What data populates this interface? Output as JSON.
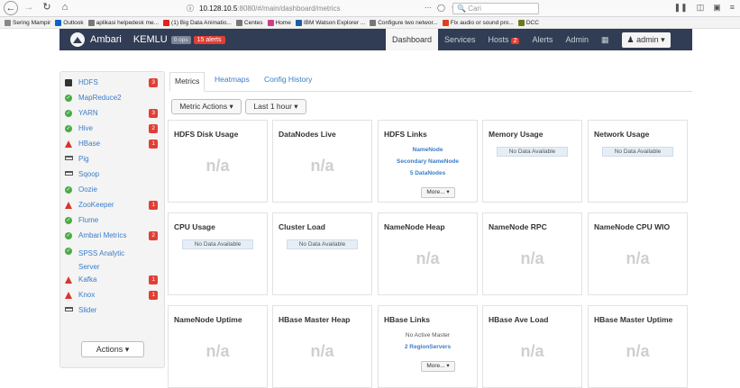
{
  "browser": {
    "url_host": "10.128.10.5",
    "url_path": ":8080/#/main/dashboard/metrics",
    "search_placeholder": "Cari"
  },
  "bookmarks": [
    {
      "label": "Sering Mampir",
      "color": "#888"
    },
    {
      "label": "Outlook",
      "color": "#0a64c7"
    },
    {
      "label": "aplikasi helpedesk me...",
      "color": "#777"
    },
    {
      "label": "(1) Big Data Animatio...",
      "color": "#e62117"
    },
    {
      "label": "Centes",
      "color": "#777"
    },
    {
      "label": "Home",
      "color": "#cf3e84"
    },
    {
      "label": "IBM Watson Explorer ...",
      "color": "#1a5ea8"
    },
    {
      "label": "Configure two networ...",
      "color": "#777"
    },
    {
      "label": "Fix audio or sound pro...",
      "color": "#e13f1b"
    },
    {
      "label": "DCC",
      "color": "#6a7b1f"
    }
  ],
  "ambari": {
    "brand": "Ambari",
    "cluster": "KEMLU",
    "ops": "0 ops",
    "alerts": "15 alerts",
    "nav": [
      {
        "label": "Dashboard",
        "active": true
      },
      {
        "label": "Services"
      },
      {
        "label": "Hosts",
        "badge": "2"
      },
      {
        "label": "Alerts"
      },
      {
        "label": "Admin"
      }
    ],
    "user": "admin"
  },
  "sidebar": {
    "services": [
      {
        "name": "HDFS",
        "icon": "storage",
        "count": "3"
      },
      {
        "name": "MapReduce2",
        "icon": "ok"
      },
      {
        "name": "YARN",
        "icon": "ok",
        "count": "3"
      },
      {
        "name": "Hive",
        "icon": "ok",
        "count": "2"
      },
      {
        "name": "HBase",
        "icon": "warn",
        "count": "1"
      },
      {
        "name": "Pig",
        "icon": "client"
      },
      {
        "name": "Sqoop",
        "icon": "client"
      },
      {
        "name": "Oozie",
        "icon": "ok"
      },
      {
        "name": "ZooKeeper",
        "icon": "warn",
        "count": "1"
      },
      {
        "name": "Flume",
        "icon": "ok"
      },
      {
        "name": "Ambari Metrics",
        "icon": "ok",
        "count": "2"
      },
      {
        "name": "SPSS Analytic Server",
        "icon": "ok"
      },
      {
        "name": "Kafka",
        "icon": "warn",
        "count": "1"
      },
      {
        "name": "Knox",
        "icon": "warn",
        "count": "1"
      },
      {
        "name": "Slider",
        "icon": "client"
      }
    ],
    "actions": "Actions"
  },
  "main": {
    "tabs": [
      "Metrics",
      "Heatmaps",
      "Config History"
    ],
    "metric_actions": "Metric Actions",
    "time_range": "Last 1 hour",
    "na": "n/a",
    "no_data": "No Data Available",
    "more": "More...",
    "widgets": [
      {
        "title": "HDFS Disk Usage",
        "kind": "na"
      },
      {
        "title": "DataNodes Live",
        "kind": "na"
      },
      {
        "title": "HDFS Links",
        "kind": "links",
        "links": [
          "NameNode",
          "Secondary NameNode",
          "5 DataNodes"
        ]
      },
      {
        "title": "Memory Usage",
        "kind": "nodata"
      },
      {
        "title": "Network Usage",
        "kind": "nodata"
      },
      {
        "title": "CPU Usage",
        "kind": "nodata"
      },
      {
        "title": "Cluster Load",
        "kind": "nodata"
      },
      {
        "title": "NameNode Heap",
        "kind": "na"
      },
      {
        "title": "NameNode RPC",
        "kind": "na"
      },
      {
        "title": "NameNode CPU WIO",
        "kind": "na"
      },
      {
        "title": "NameNode Uptime",
        "kind": "na"
      },
      {
        "title": "HBase Master Heap",
        "kind": "na"
      },
      {
        "title": "HBase Links",
        "kind": "hlinks",
        "note": "No Active Master",
        "links": [
          "2 RegionServers"
        ]
      },
      {
        "title": "HBase Ave Load",
        "kind": "na"
      },
      {
        "title": "HBase Master Uptime",
        "kind": "na"
      }
    ]
  }
}
